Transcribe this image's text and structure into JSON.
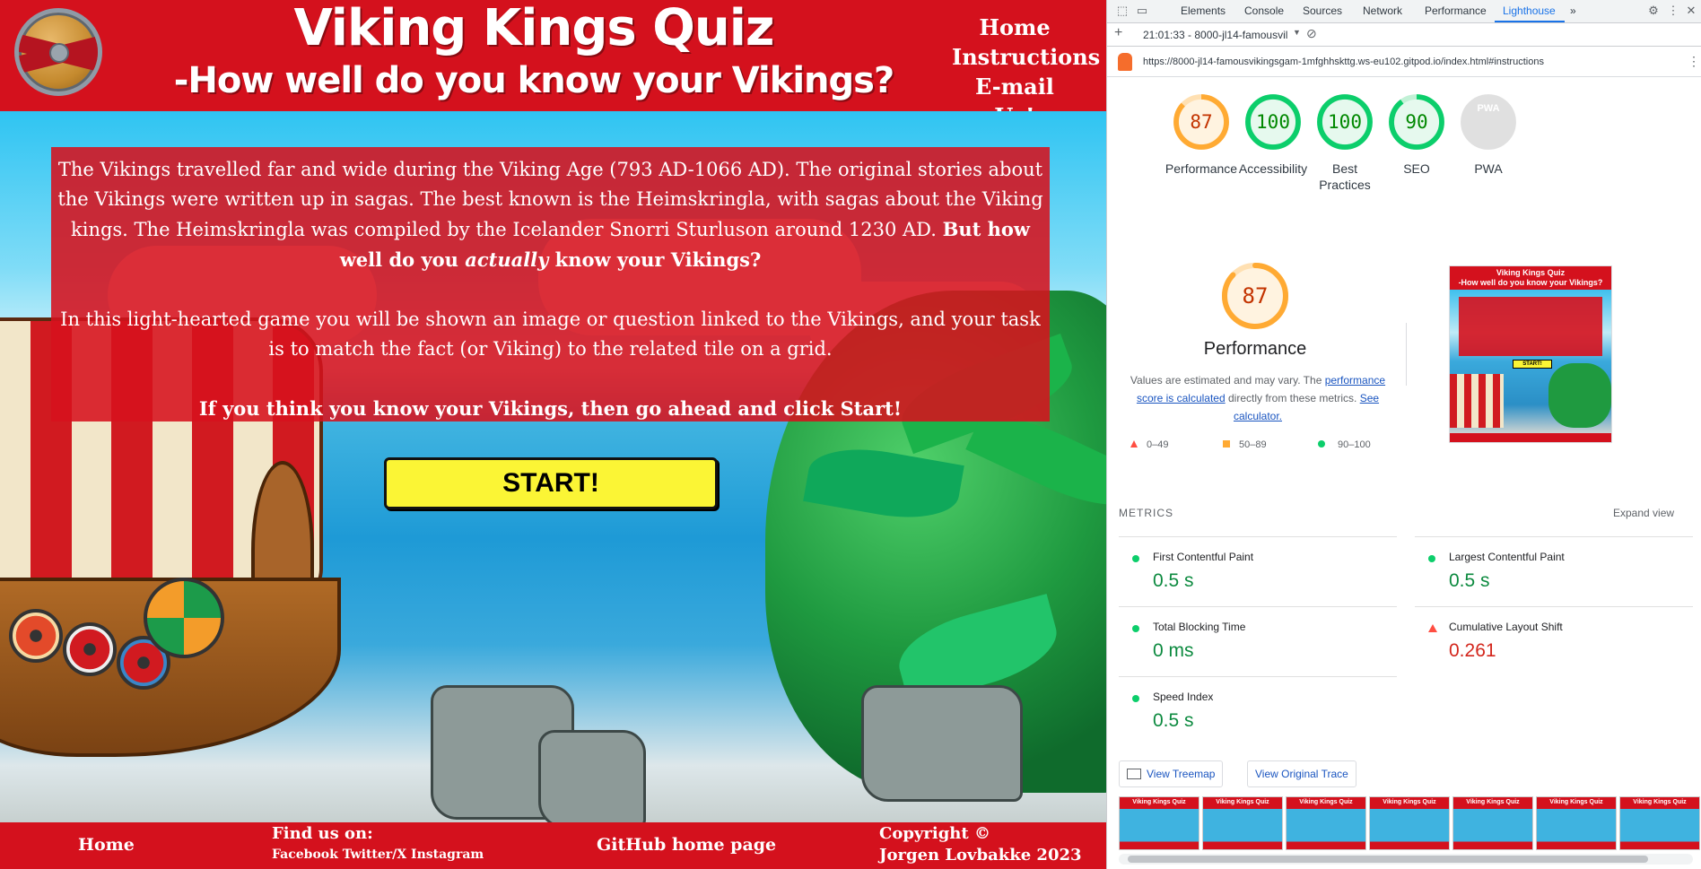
{
  "site": {
    "title_line1": "Viking Kings Quiz",
    "title_line2": "-How well do you know your Vikings?",
    "nav": [
      "Home",
      "Instructions",
      "E-mail Us!"
    ],
    "intro_p1_plain": "The Vikings travelled far and wide during the Viking Age (793 AD-1066 AD). The original stories about the Vikings were written up in sagas. The best known is the Heimskringla, with sagas about the Viking kings. The Heimskringla was compiled by the Icelander Snorri Sturluson around 1230 AD. ",
    "intro_p1_bold_a": "But how well do you ",
    "intro_p1_italic": "actually",
    "intro_p1_bold_b": " know your Vikings?",
    "intro_p2": "In this light-hearted game you will be shown an image or question linked to the Vikings, and your task is to match the fact (or Viking) to the related tile on a grid.",
    "intro_p3": "If you think you know your Vikings, then go ahead and click Start!",
    "start_label": "START!",
    "footer": {
      "home": "Home",
      "find_us": "Find us on:",
      "social": "Facebook Twitter/X Instagram",
      "github": "GitHub home page",
      "copyright_line1": "Copyright ©",
      "copyright_line2": "Jorgen Lovbakke 2023"
    }
  },
  "devtools": {
    "tabs": [
      "Elements",
      "Console",
      "Sources",
      "Network",
      "Performance",
      "Lighthouse"
    ],
    "active_tab": "Lighthouse",
    "more_tabs": "»",
    "report_select": "21:01:33 - 8000-jl14-famousvil",
    "url": "https://8000-jl14-famousvikingsgam-1mfghhskttg.ws-eu102.gitpod.io/index.html#instructions",
    "scores": [
      {
        "label": "Performance",
        "value": "87",
        "color": "#fa3",
        "num_color": "#c33300",
        "fill": 0.87
      },
      {
        "label": "Accessibility",
        "value": "100",
        "color": "#0cce6b",
        "num_color": "#008800",
        "fill": 1.0
      },
      {
        "label": "Best Practices",
        "value": "100",
        "color": "#0cce6b",
        "num_color": "#008800",
        "fill": 1.0
      },
      {
        "label": "SEO",
        "value": "90",
        "color": "#0cce6b",
        "num_color": "#008800",
        "fill": 0.9
      },
      {
        "label": "PWA",
        "value": "PWA",
        "color": "#cccccc",
        "num_color": "#ffffff",
        "fill": 0
      }
    ],
    "perf_score": "87",
    "perf_fill": 0.87,
    "perf_title": "Performance",
    "perf_desc_a": "Values are estimated and may vary. The ",
    "perf_desc_link1": "performance score is calculated",
    "perf_desc_b": " directly from these metrics. ",
    "perf_desc_link2": "See calculator.",
    "legend": [
      "0–49",
      "50–89",
      "90–100"
    ],
    "metrics_title": "METRICS",
    "expand_view": "Expand view",
    "metrics": [
      {
        "name": "First Contentful Paint",
        "value": "0.5 s",
        "status": "good"
      },
      {
        "name": "Largest Contentful Paint",
        "value": "0.5 s",
        "status": "good"
      },
      {
        "name": "Total Blocking Time",
        "value": "0 ms",
        "status": "good"
      },
      {
        "name": "Cumulative Layout Shift",
        "value": "0.261",
        "status": "bad"
      },
      {
        "name": "Speed Index",
        "value": "0.5 s",
        "status": "good"
      }
    ],
    "view_treemap": "View Treemap",
    "view_trace": "View Original Trace",
    "thumb_title_line1": "Viking Kings Quiz",
    "thumb_title_line2": "-How well do you know your Vikings?",
    "thumb_start": "START!",
    "film_title": "Viking Kings Quiz"
  }
}
